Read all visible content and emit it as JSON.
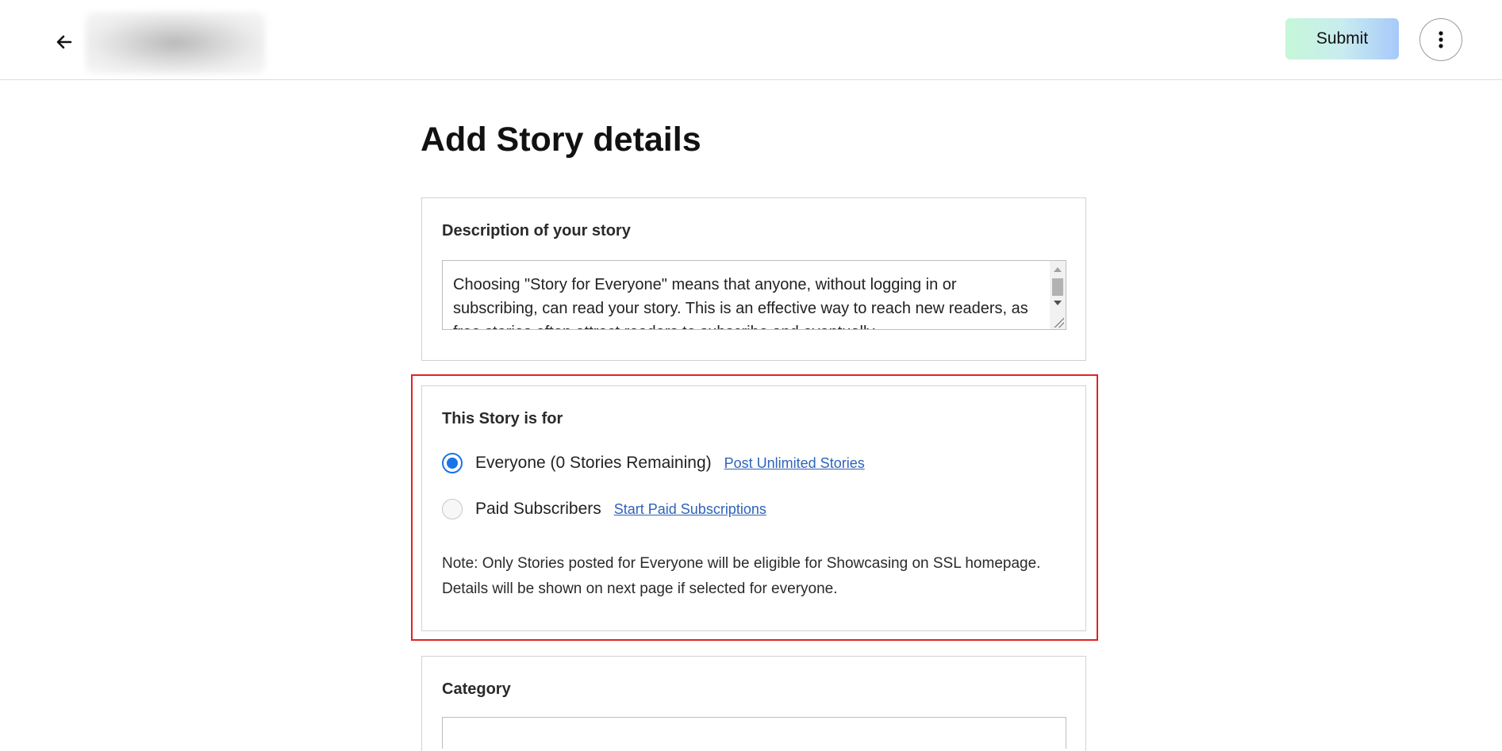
{
  "header": {
    "submit_label": "Submit"
  },
  "main": {
    "title": "Add Story details",
    "description": {
      "label": "Description of your story",
      "value": "Choosing \"Story for Everyone\" means that anyone, without logging in or subscribing, can read your story. This is an effective way to reach new readers, as free stories often attract readers to subscribe and eventually"
    },
    "audience": {
      "label": "This Story is for",
      "options": [
        {
          "label": "Everyone (0 Stories Remaining)",
          "link": "Post Unlimited Stories",
          "selected": true
        },
        {
          "label": "Paid Subscribers",
          "link": "Start Paid Subscriptions",
          "selected": false
        }
      ],
      "note": "Note: Only Stories posted for Everyone will be eligible for Showcasing on SSL homepage. Details will be shown on next page if selected for everyone."
    },
    "category": {
      "label": "Category"
    }
  },
  "colors": {
    "radio_selected": "#1a73e8",
    "link": "#2f63b8",
    "highlight_border": "#e02424"
  },
  "icons": [
    "arrow-left-icon",
    "more-vertical-icon"
  ]
}
